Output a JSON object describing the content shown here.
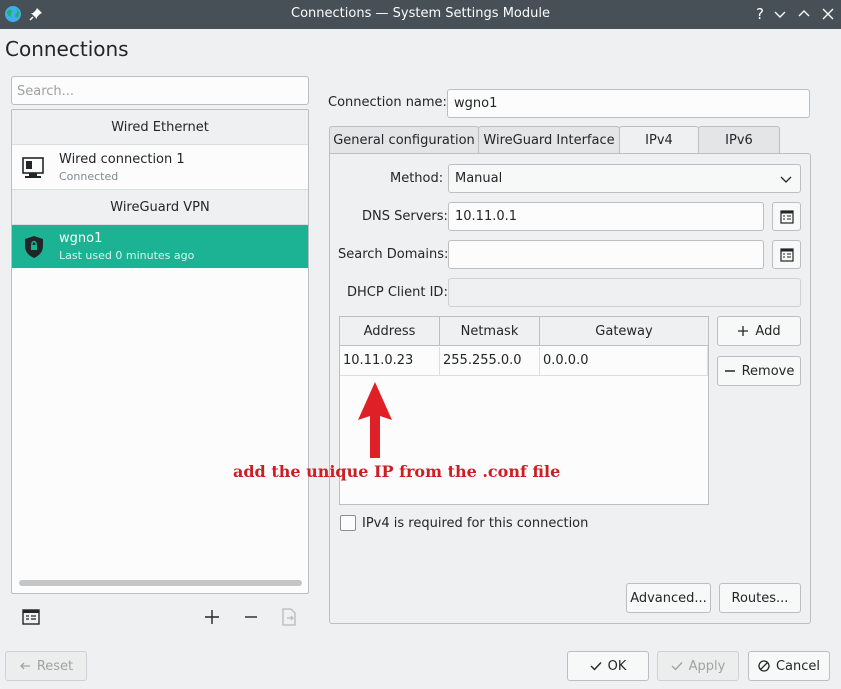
{
  "window": {
    "title": "Connections — System Settings Module",
    "help": "?"
  },
  "page": {
    "title": "Connections"
  },
  "sidebar": {
    "search_placeholder": "Search...",
    "groups": [
      {
        "header": "Wired Ethernet",
        "items": [
          {
            "name": "Wired connection 1",
            "status": "Connected"
          }
        ]
      },
      {
        "header": "WireGuard VPN",
        "items": [
          {
            "name": "wgno1",
            "status": "Last used 0 minutes ago",
            "selected": true
          }
        ]
      }
    ],
    "tools": [
      "configure-icon",
      "plus-icon",
      "minus-icon",
      "export-icon"
    ]
  },
  "form": {
    "connection_name_label": "Connection name:",
    "connection_name_value": "wgno1",
    "tabs": [
      {
        "label": "General configuration"
      },
      {
        "label": "WireGuard Interface"
      },
      {
        "label": "IPv4",
        "active": true
      },
      {
        "label": "IPv6"
      }
    ],
    "method_label": "Method:",
    "method_value": "Manual",
    "dns_label": "DNS Servers:",
    "dns_value": "10.11.0.1",
    "search_domains_label": "Search Domains:",
    "search_domains_value": "",
    "dhcp_label": "DHCP Client ID:",
    "dhcp_value": "",
    "table": {
      "columns": [
        "Address",
        "Netmask",
        "Gateway"
      ],
      "rows": [
        [
          "10.11.0.23",
          "255.255.0.0",
          "0.0.0.0"
        ]
      ]
    },
    "add_label": "Add",
    "remove_label": "Remove",
    "ipv4_required_label": "IPv4 is required for this connection",
    "ipv4_required_checked": false,
    "advanced_label": "Advanced...",
    "routes_label": "Routes..."
  },
  "annotation": {
    "text": "add the unique IP from the .conf file",
    "color": "#cc1e24"
  },
  "footer": {
    "reset_label": "Reset",
    "ok_label": "OK",
    "apply_label": "Apply",
    "cancel_label": "Cancel"
  },
  "colors": {
    "titlebar": "#475057",
    "selection": "#1cb394",
    "window_bg": "#eff0f1"
  }
}
